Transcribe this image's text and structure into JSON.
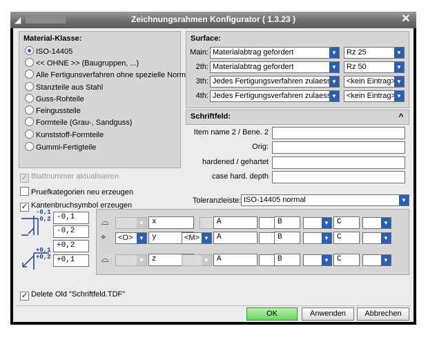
{
  "window": {
    "title": "Zeichnungsrahmen Konfigurator   ( 1.3.23 )"
  },
  "material": {
    "title": "Material-Klasse:",
    "options": [
      "ISO-14405",
      "<< OHNE >> (Baugruppen, ...)",
      "Alle Fertigunsverfahren ohne spezielle Norm",
      "Stanzteile aus Stahl",
      "Guss-Rohteile",
      "Feingussteile",
      "Formteile (Grau-, Sandguss)",
      "Kunststoff-Formteile",
      "Gummi-Fertigteile"
    ],
    "selected": 0
  },
  "checks": {
    "blattnummer": "Blattnummer aktualisieren",
    "pruef": "Pruefkategorien neu erzeugen",
    "kanten": "Kantenbruchsymbol erzeugen",
    "delete_old": "Delete Old \"Schriftfeld.TDF\""
  },
  "surface": {
    "title": "Surface:",
    "rows": [
      {
        "label": "Main:",
        "value": "Materialabtrag gefordert",
        "rz": "Rz 25"
      },
      {
        "label": "2th:",
        "value": "Materialabtrag gefordert",
        "rz": "Rz 50"
      },
      {
        "label": "3th:",
        "value": "Jedes Fertigungsverfahren zulaessig",
        "rz": "<kein Eintrag>"
      },
      {
        "label": "4th:",
        "value": "Jedes Fertigungsverfahren zulaessig",
        "rz": "<kein Eintrag>"
      }
    ]
  },
  "schriftfeld": {
    "title": "Schriftfeld:",
    "toggle": "^",
    "fields": [
      {
        "label": "Item name 2 / Bene. 2",
        "value": ""
      },
      {
        "label": "Orig:",
        "value": ""
      },
      {
        "label": "hardened / gehartet",
        "value": ""
      },
      {
        "label": "case hard. depth",
        "value": ""
      }
    ]
  },
  "toleranz": {
    "label": "Toleranzleiste:",
    "value": "ISO-14405 normal"
  },
  "tolerances": {
    "neg_top": "-0,1",
    "neg_bot": "-0,2",
    "pos_top": "+0,1",
    "pos_bot": "+0,2",
    "neg_f1": "-0,1",
    "neg_f2": "-0,2",
    "pos_f1": "+0,2",
    "pos_f2": "+0,1"
  },
  "gdt": {
    "rows": [
      {
        "sym": "⌓",
        "mod1": "",
        "axis": "x",
        "mod2": "",
        "d1": "A",
        "d2": "B",
        "d3": "C"
      },
      {
        "sym": "⌖",
        "mod1": "<O>",
        "axis": "y",
        "mod2": "<M>",
        "d1": "A",
        "d2": "B",
        "d3": "C"
      },
      {
        "sym": "⌓",
        "mod1": "",
        "axis": "z",
        "mod2": "",
        "d1": "A",
        "d2": "B",
        "d3": "C"
      }
    ]
  },
  "buttons": {
    "ok": "OK",
    "apply": "Anwenden",
    "cancel": "Abbrechen"
  }
}
